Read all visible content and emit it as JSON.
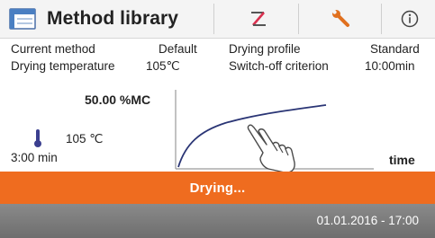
{
  "header": {
    "title": "Method library",
    "buttons": [
      {
        "icon": "edit-icon"
      },
      {
        "icon": "wrench-icon"
      },
      {
        "icon": "info-icon"
      }
    ]
  },
  "info": {
    "current_method_label": "Current method",
    "current_method_value": "Default",
    "drying_profile_label": "Drying profile",
    "drying_profile_value": "Standard",
    "drying_temperature_label": "Drying temperature",
    "drying_temperature_value": "105℃",
    "switch_off_label": "Switch-off criterion",
    "switch_off_value": "10:00min"
  },
  "measurement": {
    "moisture_value": "50.00  %MC",
    "temperature": "105 ℃",
    "elapsed_time": "3:00 min",
    "time_axis_label": "time"
  },
  "status": {
    "text": "Drying...",
    "color": "#ef6c1f"
  },
  "footer": {
    "datetime": "01.01.2016 - 17:00"
  },
  "colors": {
    "accent_orange": "#ef6c1f",
    "curve_blue": "#2a3575",
    "footer_gray": "#7a7a7a",
    "thermometer": "#3b3f8f"
  }
}
